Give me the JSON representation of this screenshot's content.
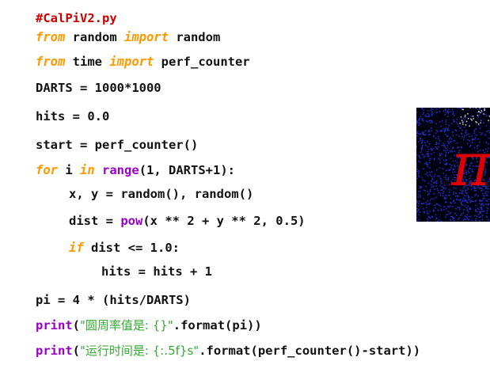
{
  "editor": {
    "lines": [
      {
        "indent": 0,
        "tokens": [
          {
            "cls": "comment",
            "text": "#CalPiV2.py"
          }
        ]
      },
      {
        "indent": 0,
        "tokens": [
          {
            "cls": "kw",
            "text": "from"
          },
          {
            "cls": "",
            "text": " random "
          },
          {
            "cls": "kw",
            "text": "import"
          },
          {
            "cls": "",
            "text": " random"
          }
        ]
      },
      {
        "indent": 0,
        "tokens": [
          {
            "cls": "kw",
            "text": "from"
          },
          {
            "cls": "",
            "text": " time "
          },
          {
            "cls": "kw",
            "text": "import"
          },
          {
            "cls": "",
            "text": " perf_counter"
          }
        ]
      },
      {
        "indent": 0,
        "tokens": [
          {
            "cls": "",
            "text": "DARTS = 1000*1000"
          }
        ]
      },
      {
        "indent": 0,
        "tokens": [
          {
            "cls": "",
            "text": "hits = 0.0"
          }
        ]
      },
      {
        "indent": 0,
        "tokens": [
          {
            "cls": "",
            "text": "start = perf_counter()"
          }
        ]
      },
      {
        "indent": 0,
        "tokens": [
          {
            "cls": "kw",
            "text": "for"
          },
          {
            "cls": "",
            "text": " i "
          },
          {
            "cls": "kw",
            "text": "in"
          },
          {
            "cls": "",
            "text": " "
          },
          {
            "cls": "bi",
            "text": "range"
          },
          {
            "cls": "",
            "text": "(1, DARTS+1):"
          }
        ]
      },
      {
        "indent": 1,
        "tokens": [
          {
            "cls": "",
            "text": "x, y = random(), random()"
          }
        ]
      },
      {
        "indent": 1,
        "tokens": [
          {
            "cls": "",
            "text": "dist = "
          },
          {
            "cls": "bi",
            "text": "pow"
          },
          {
            "cls": "",
            "text": "(x ** 2 + y ** 2, 0.5)"
          }
        ]
      },
      {
        "indent": 1,
        "tokens": [
          {
            "cls": "kw",
            "text": "if"
          },
          {
            "cls": "",
            "text": " dist <= 1.0:"
          }
        ]
      },
      {
        "indent": 2,
        "tokens": [
          {
            "cls": "",
            "text": "hits = hits + 1"
          }
        ]
      },
      {
        "indent": 0,
        "tokens": [
          {
            "cls": "",
            "text": "pi = 4 * (hits/DARTS)"
          }
        ]
      },
      {
        "indent": 0,
        "tokens": [
          {
            "cls": "bi",
            "text": "print"
          },
          {
            "cls": "",
            "text": "("
          },
          {
            "cls": "str",
            "text": "\"圆周率值是: {}\""
          },
          {
            "cls": "",
            "text": ".format(pi))"
          }
        ]
      },
      {
        "indent": 0,
        "tokens": [
          {
            "cls": "bi",
            "text": "print"
          },
          {
            "cls": "",
            "text": "("
          },
          {
            "cls": "str",
            "text": "\"运行时间是: {:.5f}s\""
          },
          {
            "cls": "",
            "text": ".format(perf_counter()-start))"
          }
        ]
      }
    ]
  },
  "pi_image": {
    "symbol": "π",
    "background_color": "#000010",
    "dot_color": "#2233cc",
    "symbol_color": "#dd0000"
  },
  "colors": {
    "comment": "#cc0000",
    "keyword": "#ff9900",
    "builtin": "#9900cc",
    "string": "#33aa33",
    "text": "#111111"
  }
}
